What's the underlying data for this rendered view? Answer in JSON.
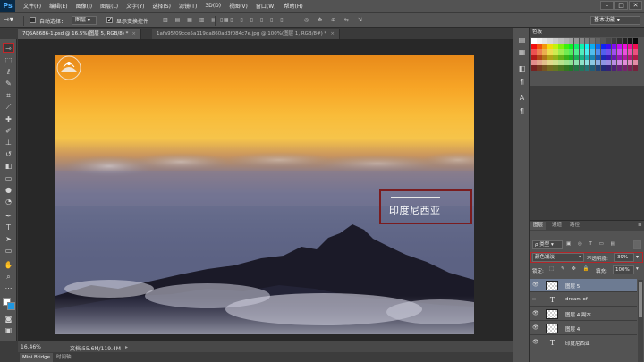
{
  "app": {
    "logo": "Ps"
  },
  "menu": [
    "文件(F)",
    "编辑(E)",
    "图像(I)",
    "图层(L)",
    "文字(Y)",
    "选择(S)",
    "滤镜(T)",
    "3D(D)",
    "视图(V)",
    "窗口(W)",
    "帮助(H)"
  ],
  "window_controls": {
    "minimize": "–",
    "maximize": "□",
    "close": "✕"
  },
  "options": {
    "auto_select_label": "自动选择：",
    "auto_select_checked": false,
    "auto_select_value": "图层",
    "show_transform_label": "显示变换控件",
    "show_transform_checked": true,
    "workspace": "基本功能"
  },
  "doc_tabs": [
    {
      "label": "7Q5A8686-1.psd @ 16.5%(图层 5, RGB/8) *",
      "close": "×",
      "active": true
    },
    {
      "label": "1afa95f09cce5a119da860ad3f084c7e.jpg @ 100%(图层 1, RGB/8#) *",
      "close": "×",
      "active": false
    }
  ],
  "canvas_overlay": {
    "title": "印度尼西亚"
  },
  "status": {
    "zoom": "16.46%",
    "doc_size": "文档:55.6M/119.4M"
  },
  "bottom_tabs": [
    "Mini Bridge",
    "时间轴"
  ],
  "swatches_panel": {
    "title": "色板"
  },
  "layers_panel": {
    "tabs": [
      "图层",
      "通道",
      "路径"
    ],
    "filter_kind": "ρ 类型",
    "blend_mode": "颜色减淡",
    "opacity_label": "不透明度:",
    "opacity_value": "39%",
    "lock_label": "锁定:",
    "fill_label": "填充:",
    "fill_value": "100%",
    "layers": [
      {
        "name": "图层 5",
        "type": "pixel",
        "active": true
      },
      {
        "name": "dream of",
        "type": "text",
        "active": false
      },
      {
        "name": "图层 4 副本",
        "type": "pixel",
        "active": false
      },
      {
        "name": "图层 4",
        "type": "pixel",
        "active": false
      },
      {
        "name": "印度尼西亚",
        "type": "text",
        "active": false
      }
    ]
  },
  "colors": {
    "accent_red": "#b3262a",
    "active_layer": "#6d7b92",
    "panel_bg": "#535353"
  }
}
